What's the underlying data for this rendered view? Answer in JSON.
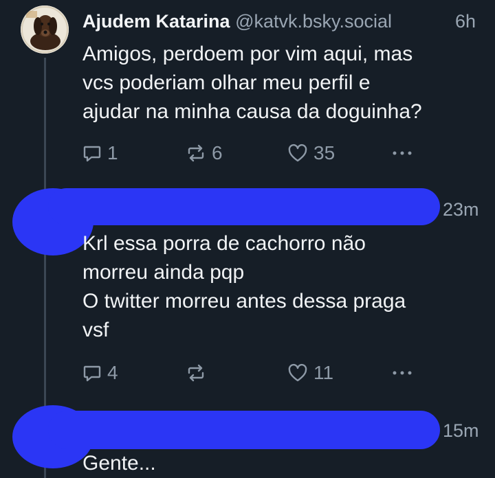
{
  "posts": [
    {
      "author_name": "Ajudem Katarina",
      "handle": "@katvk.bsky.social",
      "time": "6h",
      "lines": [
        "Amigos, perdoem por vim aqui, mas",
        "vcs poderiam olhar meu perfil e",
        "ajudar na minha causa da doguinha?"
      ],
      "replies": "1",
      "reposts": "6",
      "likes": "35",
      "avatar_icon": "dog-photo-avatar"
    },
    {
      "time": "23m",
      "lines": [
        "Krl essa porra de cachorro não",
        "morreu ainda pqp",
        "O twitter morreu antes dessa praga",
        "vsf"
      ],
      "replies": "4",
      "reposts": "",
      "likes": "11",
      "redacted": true
    },
    {
      "time": "15m",
      "lines": [
        "Gente..."
      ],
      "redacted": true
    }
  ],
  "icons": {
    "reply": "reply-icon",
    "repost": "repost-icon",
    "like": "heart-icon",
    "more": "more-options-icon"
  },
  "colors": {
    "background": "#161e27",
    "redaction": "#2b36f5",
    "muted": "#8e9aa7"
  }
}
